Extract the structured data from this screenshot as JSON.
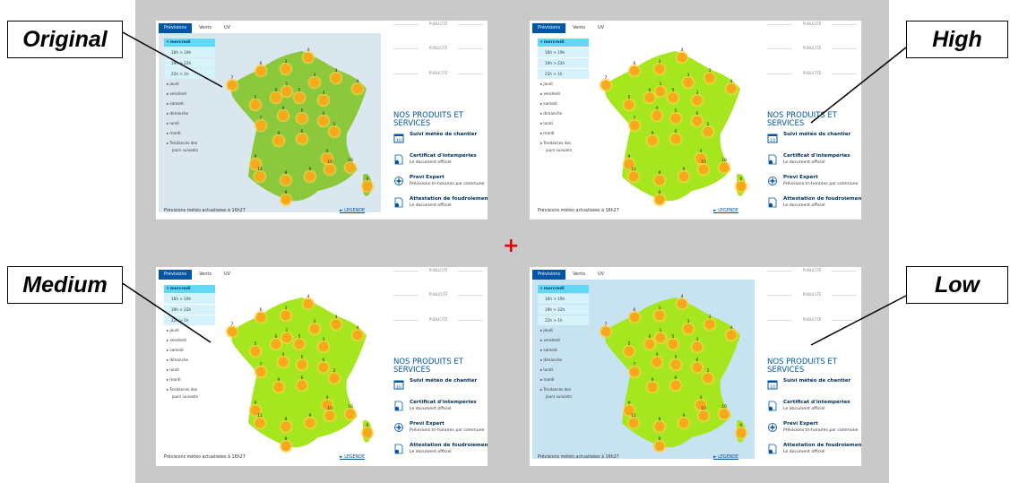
{
  "callouts": {
    "original": "Original",
    "high": "High",
    "medium": "Medium",
    "low": "Low",
    "plus": "+"
  },
  "colors": {
    "stage": "#c9c9c9",
    "sea_original": "#dbe7ef",
    "sea_low": "#c7e2f1",
    "land_original": "#8cc83c",
    "land_bright": "#a6e61e",
    "sun": "#f7a81b",
    "sun_ring": "#ffd447",
    "accent": "#0055a4",
    "day_highlight": "#62d8f7"
  },
  "panel": {
    "tabs": [
      "Prévisions",
      "Vents",
      "UV"
    ],
    "day_header": "▾ mercredi",
    "slots": [
      "16h > 19h",
      "19h > 22h",
      "22h > 1h"
    ],
    "days": [
      "▸ jeudi",
      "▸ vendredi",
      "▸ samedi",
      "▸ dimanche",
      "▸ lundi",
      "▸ mardi",
      "▸ Tendances des"
    ],
    "days_tail": "jours suivants",
    "pub": "PUBLICITÉ",
    "products_title_1": "NOS PRODUITS ET",
    "products_title_2": "SERVICES",
    "products": [
      {
        "title": "Suivi météo de chantier",
        "sub": "",
        "icon": "calendar-icon",
        "badge": "10"
      },
      {
        "title": "Certificat d'intempéries",
        "sub": "Le document officiel",
        "icon": "document-check-icon"
      },
      {
        "title": "Previ Expert",
        "sub": "Prévisions tri-horaires par commune",
        "icon": "compass-icon"
      },
      {
        "title": "Attestation de foudroiement",
        "sub": "Le document officiel",
        "icon": "document-check-icon"
      }
    ],
    "footer": "Prévisions météo actualisées à 16h27",
    "legend": "► LEGENDE",
    "temperatures": [
      {
        "city": "nw-brest",
        "value": "7"
      },
      {
        "city": "cherbourg",
        "value": "6"
      },
      {
        "city": "lille",
        "value": "4"
      },
      {
        "city": "rouen",
        "value": "3"
      },
      {
        "city": "paris",
        "value": "1"
      },
      {
        "city": "reims",
        "value": "3"
      },
      {
        "city": "metz",
        "value": "3"
      },
      {
        "city": "strasbourg",
        "value": "4"
      },
      {
        "city": "rennes",
        "value": "5"
      },
      {
        "city": "le-mans",
        "value": "6"
      },
      {
        "city": "orleans",
        "value": "5"
      },
      {
        "city": "dijon",
        "value": "3"
      },
      {
        "city": "nantes",
        "value": "7"
      },
      {
        "city": "tours",
        "value": "4"
      },
      {
        "city": "bourges",
        "value": "5"
      },
      {
        "city": "besancon",
        "value": "6"
      },
      {
        "city": "limoges",
        "value": "9"
      },
      {
        "city": "clermont",
        "value": "6"
      },
      {
        "city": "lyon",
        "value": "2"
      },
      {
        "city": "bordeaux",
        "value": "9"
      },
      {
        "city": "grenoble",
        "value": "4"
      },
      {
        "city": "biarritz",
        "value": "11"
      },
      {
        "city": "toulouse",
        "value": "8"
      },
      {
        "city": "montpellier",
        "value": "9"
      },
      {
        "city": "marseille",
        "value": "10"
      },
      {
        "city": "nice",
        "value": "10"
      },
      {
        "city": "perpignan",
        "value": "8"
      },
      {
        "city": "ajaccio",
        "value": "6"
      }
    ]
  }
}
